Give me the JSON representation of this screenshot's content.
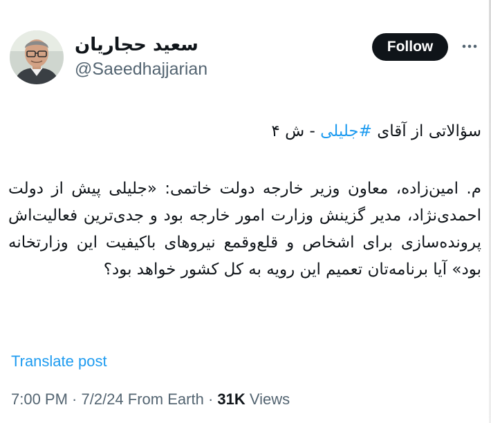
{
  "author": {
    "display_name": "سعید حجاریان",
    "handle": "@Saeedhajjarian"
  },
  "actions": {
    "follow_label": "Follow",
    "more_icon": "more-horizontal-icon"
  },
  "post": {
    "title_prefix": "سؤالاتی از آقای ",
    "hashtag": "#جلیلی",
    "title_suffix": " - ش ۴",
    "paragraph": "م. امین‌زاده، معاون وزیر خارجه دولت خاتمی: «جلیلی پیش از دولت احمدی‌نژاد، مدیر گزینش وزارت امور خارجه بود و جدی‌ترین فعالیت‌اش پرونده‌سازی برای اشخاص و قلع‌وقمع نیروهای باکیفیت این وزارتخانه بود» آیا برنامه‌تان تعمیم این رویه به کل کشور خواهد بود؟"
  },
  "translate_label": "Translate post",
  "meta": {
    "time": "7:00 PM",
    "separator": " · ",
    "date": "7/2/24",
    "source": "From Earth",
    "views_count": "31K",
    "views_label": " Views"
  },
  "colors": {
    "link": "#1d9bf0",
    "text": "#0f1419",
    "secondary": "#536471",
    "button_bg": "#0f1419"
  }
}
